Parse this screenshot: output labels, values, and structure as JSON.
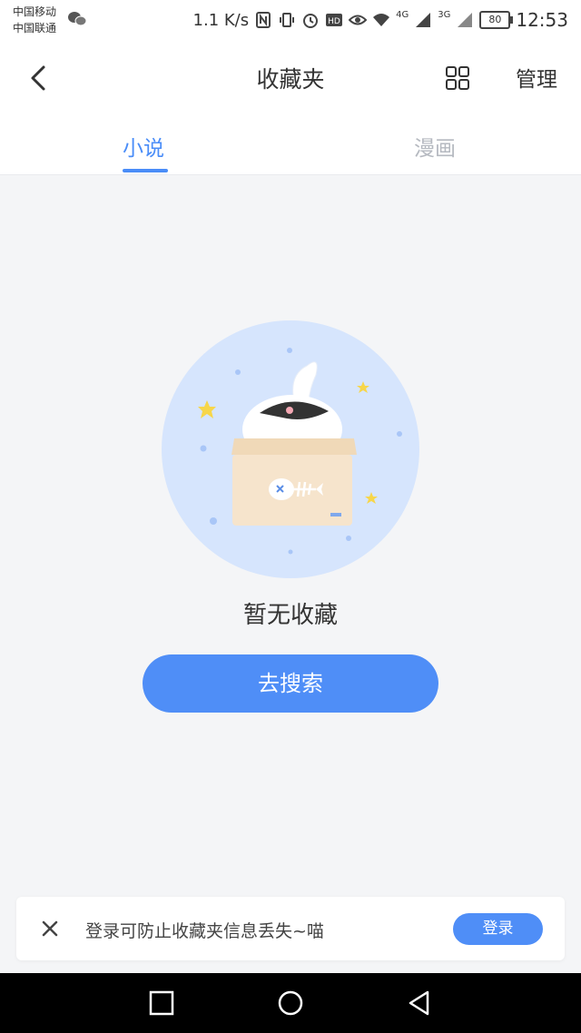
{
  "statusbar": {
    "carrier_1": "中国移动",
    "carrier_2": "中国联通",
    "net_speed": "1.1 K/s",
    "net_4g": "4G",
    "net_3g": "3G",
    "battery": "80",
    "time": "12:53",
    "icons": [
      "wechat-icon",
      "nfc-icon",
      "vibrate-icon",
      "alarm-icon",
      "hd-icon",
      "eye-icon",
      "wifi-icon",
      "signal-icon"
    ]
  },
  "header": {
    "title": "收藏夹",
    "manage_label": "管理",
    "icons": [
      "back-icon",
      "grid-view-icon"
    ]
  },
  "tabs": [
    {
      "label": "小说",
      "active": true
    },
    {
      "label": "漫画",
      "active": false
    }
  ],
  "empty_state": {
    "message": "暂无收藏",
    "button_label": "去搜索"
  },
  "login_banner": {
    "text": "登录可防止收藏夹信息丢失~喵",
    "button_label": "登录"
  },
  "colors": {
    "accent": "#4f8ef7",
    "tab_active": "#4a8df8",
    "tab_inactive": "#b5b9c0",
    "background": "#f4f5f7",
    "illustration_circle": "#d6e5fd"
  }
}
